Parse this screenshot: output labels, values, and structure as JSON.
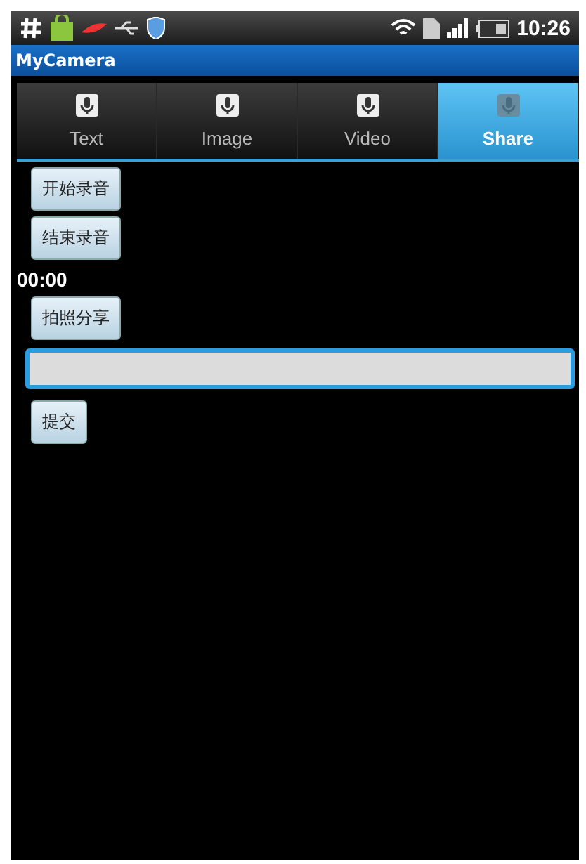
{
  "status_bar": {
    "time": "10:26"
  },
  "app_title": "MyCamera",
  "tabs": [
    {
      "label": "Text",
      "selected": false
    },
    {
      "label": "Image",
      "selected": false
    },
    {
      "label": "Video",
      "selected": false
    },
    {
      "label": "Share",
      "selected": true
    }
  ],
  "content": [
    {
      "kind": "button",
      "label": "开始录音"
    },
    {
      "kind": "button",
      "label": "结束录音"
    },
    {
      "kind": "text",
      "label": "00:00"
    },
    {
      "kind": "button",
      "label": "拍照分享"
    },
    {
      "kind": "field"
    },
    {
      "kind": "button",
      "label": "提交"
    }
  ]
}
